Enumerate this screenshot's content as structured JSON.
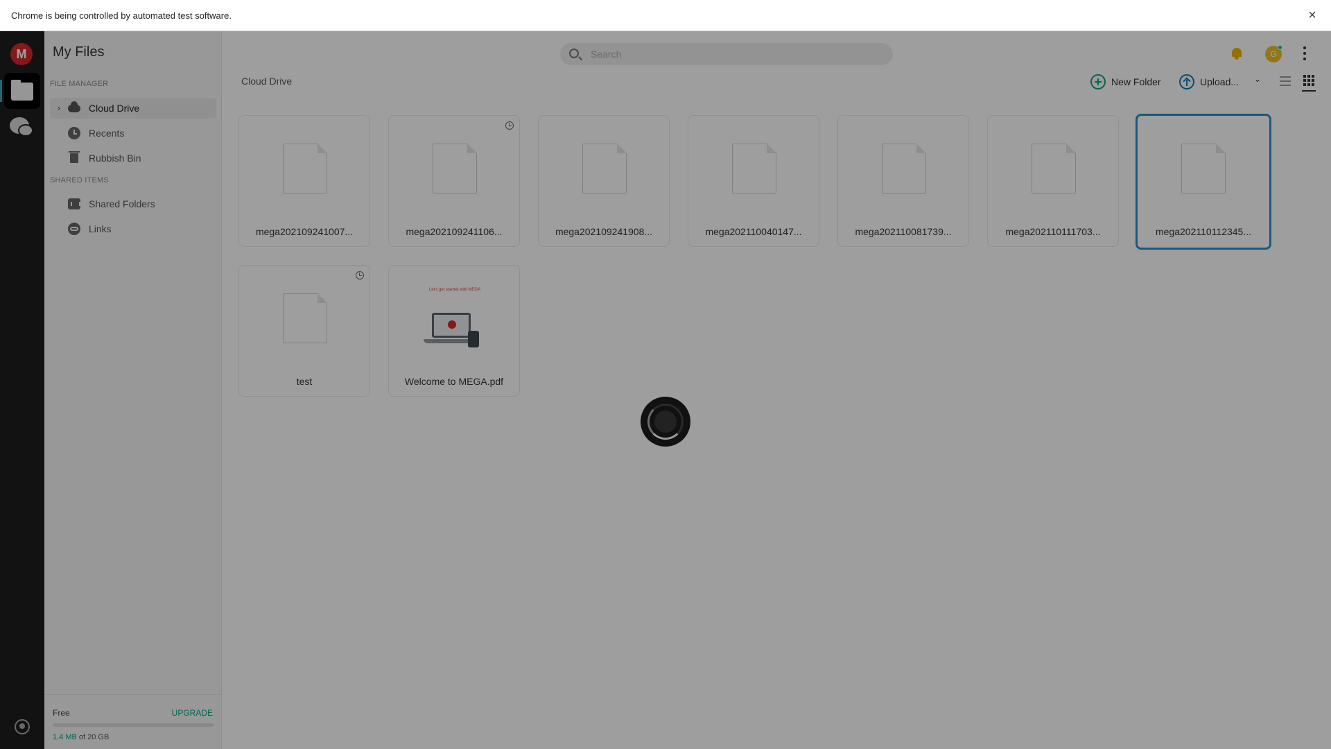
{
  "infobar": {
    "message": "Chrome is being controlled by automated test software.",
    "close_symbol": "×"
  },
  "rail": {
    "logo_letter": "M"
  },
  "sidebar": {
    "title": "My Files",
    "file_manager_label": "FILE MANAGER",
    "shared_items_label": "SHARED ITEMS",
    "items": [
      {
        "label": "Cloud Drive",
        "icon": "cloud-icon",
        "selected": true
      },
      {
        "label": "Recents",
        "icon": "clock-icon"
      },
      {
        "label": "Rubbish Bin",
        "icon": "trash-icon"
      },
      {
        "label": "Shared Folders",
        "icon": "shared-folders-icon"
      },
      {
        "label": "Links",
        "icon": "link-icon"
      }
    ],
    "storage": {
      "plan": "Free",
      "upgrade": "UPGRADE",
      "used": "1.4 MB",
      "total_text": " of 20 GB",
      "used_fraction": 7e-05
    }
  },
  "header": {
    "search_placeholder": "Search",
    "avatar_letter": "G"
  },
  "toolbar": {
    "breadcrumb": "Cloud Drive",
    "new_folder": "New Folder",
    "upload": "Upload...",
    "view_mode": "grid"
  },
  "files": [
    {
      "name": "mega202109241007...",
      "type": "file",
      "versioned": false,
      "selected": false
    },
    {
      "name": "mega202109241106...",
      "type": "file",
      "versioned": true,
      "selected": false
    },
    {
      "name": "mega202109241908...",
      "type": "file",
      "versioned": false,
      "selected": false
    },
    {
      "name": "mega202110040147...",
      "type": "file",
      "versioned": false,
      "selected": false
    },
    {
      "name": "mega202110081739...",
      "type": "file",
      "versioned": false,
      "selected": false
    },
    {
      "name": "mega202110111703...",
      "type": "file",
      "versioned": false,
      "selected": false
    },
    {
      "name": "mega202110112345...",
      "type": "file",
      "versioned": false,
      "selected": true
    },
    {
      "name": "test",
      "type": "file",
      "versioned": true,
      "selected": false
    },
    {
      "name": "Welcome to MEGA.pdf",
      "type": "pdf",
      "versioned": false,
      "selected": false,
      "thumb_caption": "Let's get started with MEGA"
    }
  ],
  "colors": {
    "accent_green": "#00a382",
    "brand_red": "#d9272e",
    "selection_blue": "#2e8ec7"
  },
  "loading": true
}
